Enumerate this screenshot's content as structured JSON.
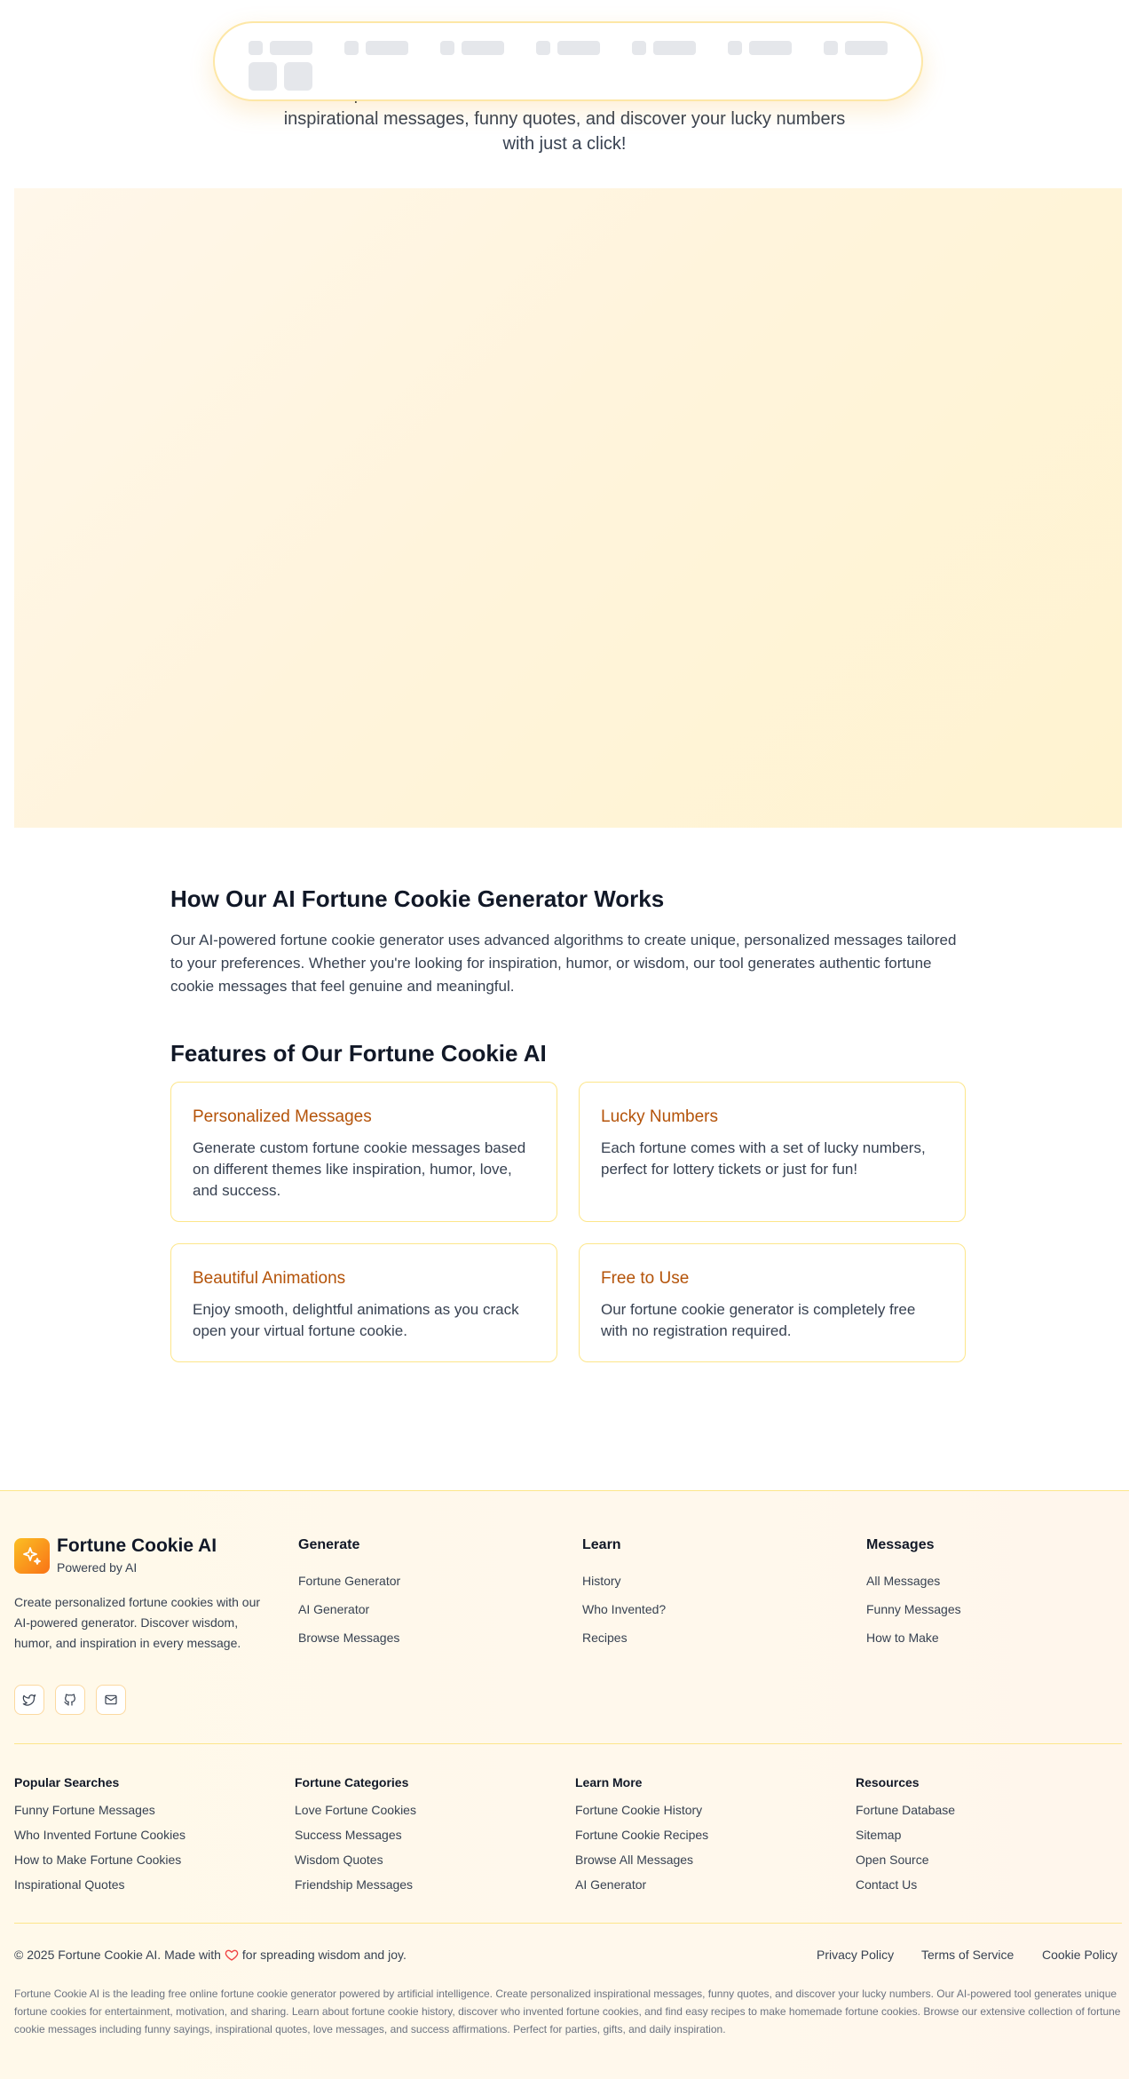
{
  "nav": {
    "icons": [
      "nav-item-icon"
    ],
    "loading": true
  },
  "hero": {
    "subtitle": "Create personalized fortune cookies with our advanced AI. Generate inspirational messages, funny quotes, and discover your lucky numbers with just a click!"
  },
  "how": {
    "title": "How Our AI Fortune Cookie Generator Works",
    "body": "Our AI-powered fortune cookie generator uses advanced algorithms to create unique, personalized messages tailored to your preferences. Whether you're looking for inspiration, humor, or wisdom, our tool generates authentic fortune cookie messages that feel genuine and meaningful."
  },
  "features": {
    "title": "Features of Our Fortune Cookie AI",
    "cards": [
      {
        "title": "Personalized Messages",
        "body": "Generate custom fortune cookie messages based on different themes like inspiration, humor, love, and success."
      },
      {
        "title": "Lucky Numbers",
        "body": "Each fortune comes with a set of lucky numbers, perfect for lottery tickets or just for fun!"
      },
      {
        "title": "Beautiful Animations",
        "body": "Enjoy smooth, delightful animations as you crack open your virtual fortune cookie."
      },
      {
        "title": "Free to Use",
        "body": "Our fortune cookie generator is completely free with no registration required."
      }
    ]
  },
  "footer": {
    "brand": {
      "name": "Fortune Cookie AI",
      "tagline": "Powered by AI",
      "description": "Create personalized fortune cookies with our AI-powered generator. Discover wisdom, humor, and inspiration in every message.",
      "logo_icon": "sparkles-icon",
      "social_icons": [
        "twitter-icon",
        "github-icon",
        "mail-icon"
      ]
    },
    "columns": [
      {
        "title": "Generate",
        "links": [
          "Fortune Generator",
          "AI Generator",
          "Browse Messages"
        ]
      },
      {
        "title": "Learn",
        "links": [
          "History",
          "Who Invented?",
          "Recipes"
        ]
      },
      {
        "title": "Messages",
        "links": [
          "All Messages",
          "Funny Messages",
          "How to Make"
        ]
      }
    ],
    "sub_columns": [
      {
        "title": "Popular Searches",
        "links": [
          "Funny Fortune Messages",
          "Who Invented Fortune Cookies",
          "How to Make Fortune Cookies",
          "Inspirational Quotes"
        ]
      },
      {
        "title": "Fortune Categories",
        "links": [
          "Love Fortune Cookies",
          "Success Messages",
          "Wisdom Quotes",
          "Friendship Messages"
        ]
      },
      {
        "title": "Learn More",
        "links": [
          "Fortune Cookie History",
          "Fortune Cookie Recipes",
          "Browse All Messages",
          "AI Generator"
        ]
      },
      {
        "title": "Resources",
        "links": [
          "Fortune Database",
          "Sitemap",
          "Open Source",
          "Contact Us"
        ]
      }
    ],
    "copyright_prefix": "© 2025 Fortune Cookie AI. Made with",
    "copyright_suffix": "for spreading wisdom and joy.",
    "heart_color": "#ef4444",
    "legal": [
      "Privacy Policy",
      "Terms of Service",
      "Cookie Policy"
    ],
    "seo_text": "Fortune Cookie AI is the leading free online fortune cookie generator powered by artificial intelligence. Create personalized inspirational messages, funny quotes, and discover your lucky numbers. Our AI-powered tool generates unique fortune cookies for entertainment, motivation, and sharing. Learn about fortune cookie history, discover who invented fortune cookies, and find easy recipes to make homemade fortune cookies. Browse our extensive collection of fortune cookie messages including funny sayings, inspirational quotes, love messages, and success affirmations. Perfect for parties, gifts, and daily inspiration."
  },
  "colors": {
    "accent": "#b45309",
    "border": "#fde68a",
    "brand_gradient": [
      "#fbbf24",
      "#f97316"
    ]
  }
}
